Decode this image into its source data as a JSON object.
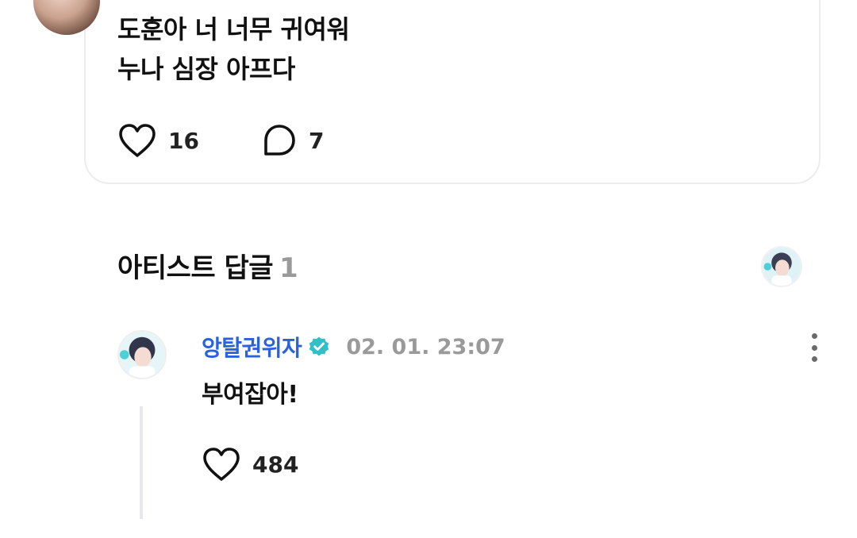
{
  "post": {
    "lines": [
      "도훈아 너 너무 귀여워",
      "누나 심장 아프다"
    ],
    "like_count": "16",
    "comment_count": "7",
    "icons": {
      "like": "heart-outline-icon",
      "comment": "speech-bubble-icon"
    }
  },
  "artist_replies": {
    "title": "아티스트 답글",
    "count": "1"
  },
  "reply": {
    "author": "앙탈권위자",
    "verified_icon": "verified-badge-icon",
    "timestamp": "02. 01. 23:07",
    "text": "부여잡아!",
    "like_count": "484"
  },
  "colors": {
    "author": "#2a61de",
    "verified": "#2fc0c8",
    "muted": "#9a9a9a",
    "card_border": "#ececec",
    "thread_line": "#e7e7ee"
  }
}
